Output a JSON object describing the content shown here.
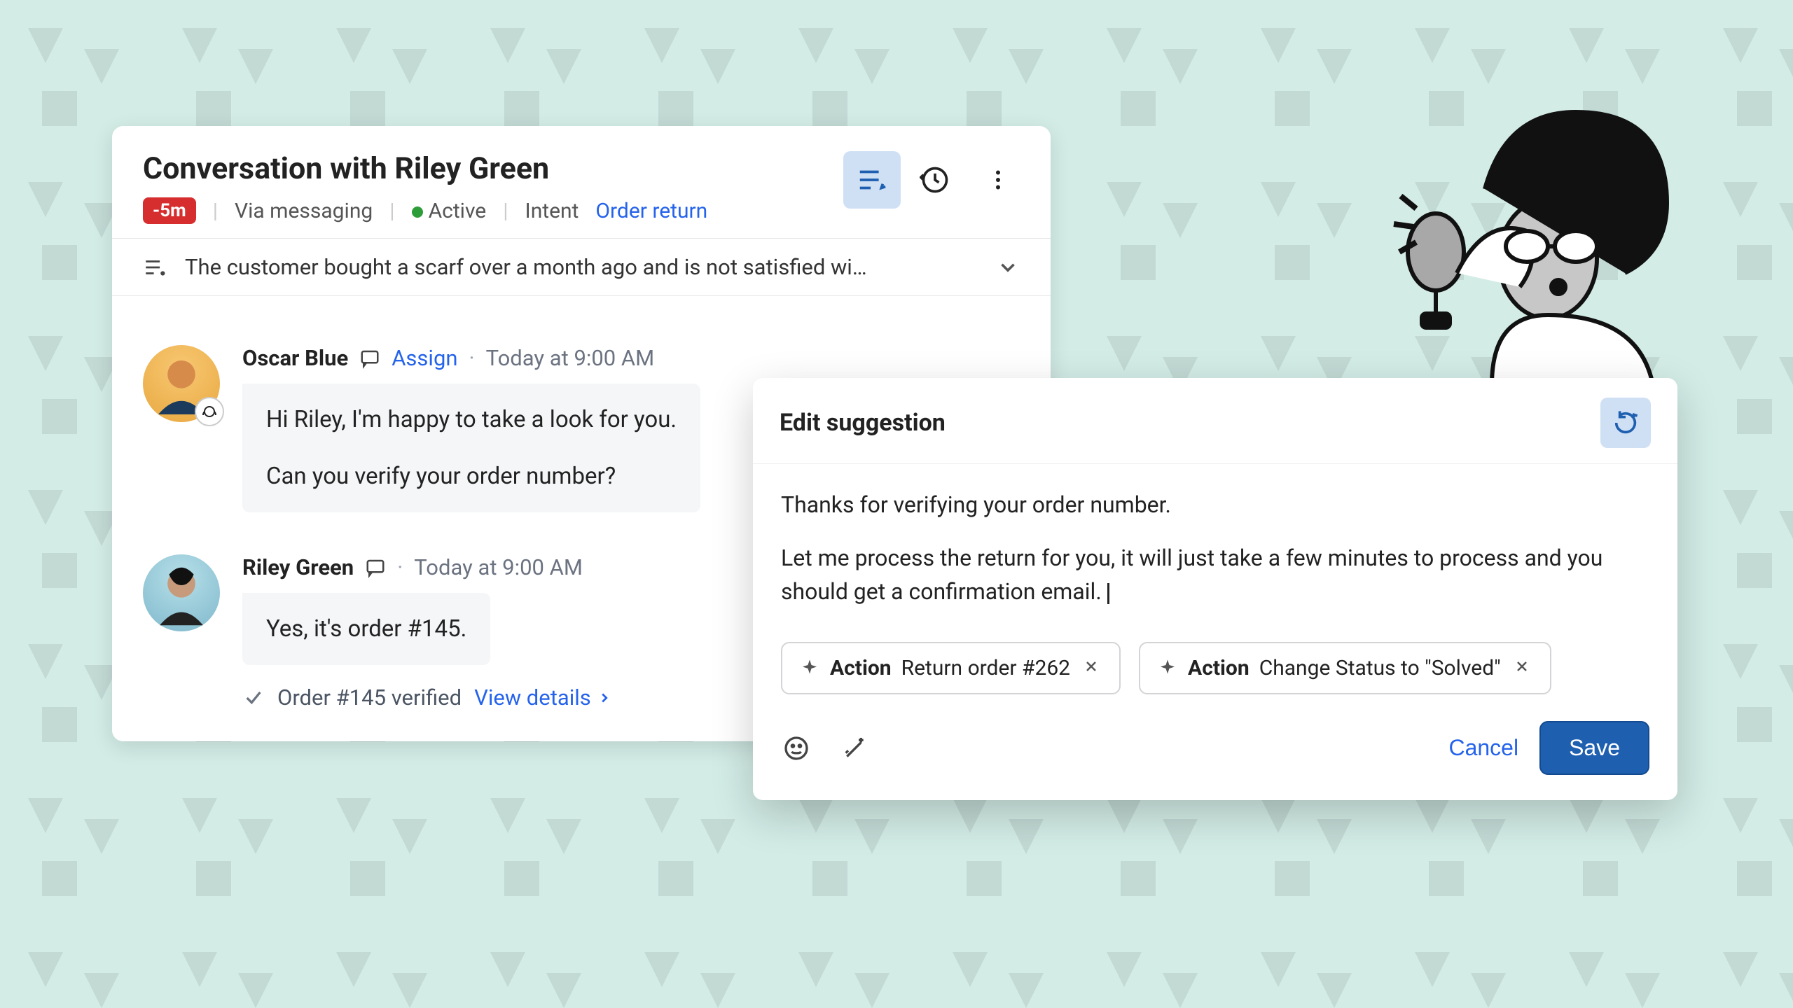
{
  "conversation": {
    "title": "Conversation with Riley Green",
    "time_badge": "-5m",
    "channel": "Via messaging",
    "status": "Active",
    "intent_label": "Intent",
    "intent_value": "Order return",
    "summary": "The customer bought a scarf over a month ago and is not satisfied wi…"
  },
  "messages": [
    {
      "name": "Oscar Blue",
      "assign": "Assign",
      "time": "Today at 9:00 AM",
      "line1": "Hi Riley, I'm happy to take a look for you.",
      "line2": "Can you verify your order number?"
    },
    {
      "name": "Riley Green",
      "time": "Today at 9:00 AM",
      "text": "Yes, it's order #145."
    }
  ],
  "verify": {
    "text": "Order #145 verified",
    "link": "View details"
  },
  "edit": {
    "title": "Edit suggestion",
    "p1": "Thanks for verifying your order number.",
    "p2": "Let me process the return for you, it will just take a few minutes to process and you should get a confirmation email.",
    "action1_label": "Action",
    "action1_text": "Return order #262",
    "action2_label": "Action",
    "action2_text": "Change Status to \"Solved\"",
    "cancel": "Cancel",
    "save": "Save"
  }
}
